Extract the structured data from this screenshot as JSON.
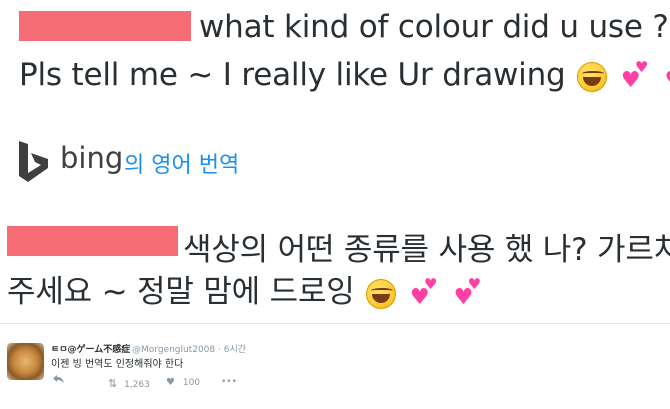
{
  "post": {
    "line1": "what kind of colour did u use ?",
    "line2": "Pls tell me ~ I really like Ur drawing",
    "emoji": [
      "face-with-tears-of-joy",
      "two-hearts",
      "two-hearts"
    ]
  },
  "translator": {
    "brand": "bing",
    "label": "의 영어 번역",
    "line1": "색상의 어떤 종류를 사용 했 나? 가르쳐",
    "line2": "주세요 ~ 정말 맘에 드로잉"
  },
  "tweet": {
    "display_name": "ㅌㅁ@ゲーム不感症",
    "handle": "@Morgenglut2008",
    "time": "6시간",
    "text": "이젠 빙 번역도 인정해줘야 한다",
    "retweets": "1,263",
    "likes": "100",
    "more": "•••"
  },
  "colors": {
    "redaction": "#f66c75",
    "bing_blue": "#1b8ff2",
    "text": "#292f33",
    "muted": "#8899a6"
  }
}
